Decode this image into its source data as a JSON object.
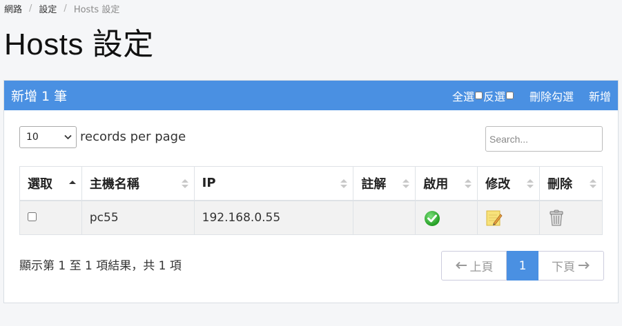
{
  "breadcrumb": {
    "items": [
      "網路",
      "設定",
      "Hosts 設定"
    ]
  },
  "page": {
    "title": "Hosts 設定"
  },
  "panel": {
    "title": "新增 1 筆",
    "select_all_label": "全選",
    "invert_label": "反選",
    "delete_checked_label": "刪除勾選",
    "add_label": "新增"
  },
  "controls": {
    "page_length": "10",
    "page_length_label": "records per page",
    "search_placeholder": "Search..."
  },
  "table": {
    "columns": [
      "選取",
      "主機名稱",
      "IP",
      "註解",
      "啟用",
      "修改",
      "刪除"
    ],
    "sorted_column": "選取",
    "rows": [
      {
        "selected": false,
        "hostname": "pc55",
        "ip": "192.168.0.55",
        "comment": "",
        "enabled_icon": "check-circle-icon",
        "edit_icon": "edit-note-icon",
        "delete_icon": "trash-can-icon"
      }
    ]
  },
  "footer": {
    "info": "顯示第 1 至 1 項結果，共 1 項",
    "prev_label": "上頁",
    "current_page": "1",
    "next_label": "下頁"
  },
  "colors": {
    "accent": "#4a90e2",
    "enabled_green": "#3bb53b"
  }
}
